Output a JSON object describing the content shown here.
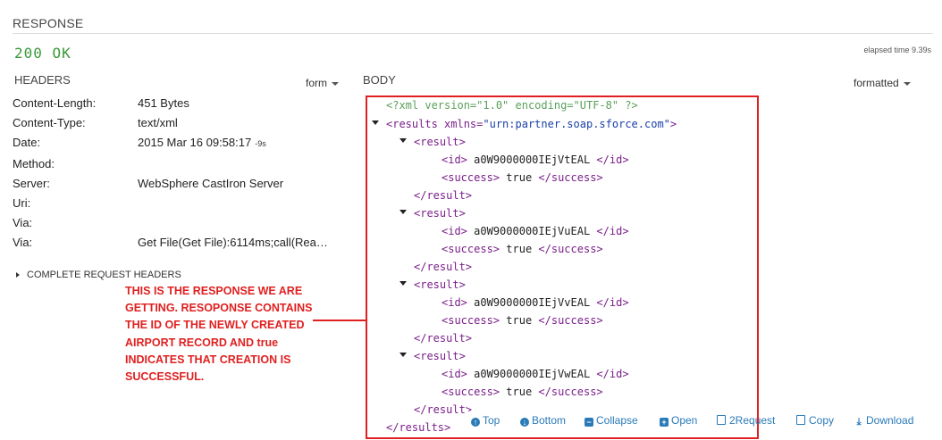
{
  "response": {
    "title": "RESPONSE",
    "status": "200 OK",
    "elapsed": "elapsed time 9.39s"
  },
  "headers": {
    "title": "HEADERS",
    "view_mode": "form",
    "rows": [
      {
        "key": "Content-Length:",
        "value": "451 Bytes",
        "sub": ""
      },
      {
        "key": "Content-Type:",
        "value": "text/xml",
        "sub": ""
      },
      {
        "key": "Date:",
        "value": "2015 Mar 16 09:58:17",
        "sub": "-9s"
      },
      {
        "key": "Method:",
        "value": "",
        "sub": ""
      },
      {
        "key": "Server:",
        "value": "WebSphere CastIron Server",
        "sub": ""
      },
      {
        "key": "Uri:",
        "value": "",
        "sub": ""
      },
      {
        "key": "Via:",
        "value": "",
        "sub": ""
      },
      {
        "key": "Via:",
        "value": "Get File(Get File):6114ms;call(Rea…",
        "sub": ""
      }
    ],
    "complete_request_headers": "COMPLETE REQUEST HEADERS"
  },
  "body": {
    "title": "BODY",
    "view_mode": "formatted",
    "xml_decl": "<?xml version=\"1.0\" encoding=\"UTF-8\" ?>",
    "root_open_tag": "<results",
    "root_attr_name": " xmlns=",
    "root_attr_value": "\"urn:partner.soap.sforce.com\"",
    "root_open_close": ">",
    "root_close": "</results>",
    "result_open": "<result>",
    "result_close": "</result>",
    "id_open": "<id>",
    "id_close": "</id>",
    "success_open": "<success>",
    "success_close": "</success>",
    "results": [
      {
        "id": "a0W9000000IEjVtEAL",
        "success": "true"
      },
      {
        "id": "a0W9000000IEjVuEAL",
        "success": "true"
      },
      {
        "id": "a0W9000000IEjVvEAL",
        "success": "true"
      },
      {
        "id": "a0W9000000IEjVwEAL",
        "success": "true"
      }
    ]
  },
  "annotation": {
    "text": "THIS IS THE RESPONSE WE ARE GETTING. RESOPONSE CONTAINS THE ID OF THE NEWLY CREATED AIRPORT RECORD AND true INDICATES THAT CREATION IS SUCCESSFUL."
  },
  "toolbar": {
    "top": "Top",
    "bottom": "Bottom",
    "collapse": "Collapse",
    "open": "Open",
    "to_request": "2Request",
    "copy": "Copy",
    "download": "Download"
  },
  "colors": {
    "status_green": "#3a9a3a",
    "annotation_red": "#e02020",
    "link_blue": "#2a7ab8",
    "xml_tag": "#7a1f8a",
    "xml_attr_value": "#1a3fa8"
  }
}
